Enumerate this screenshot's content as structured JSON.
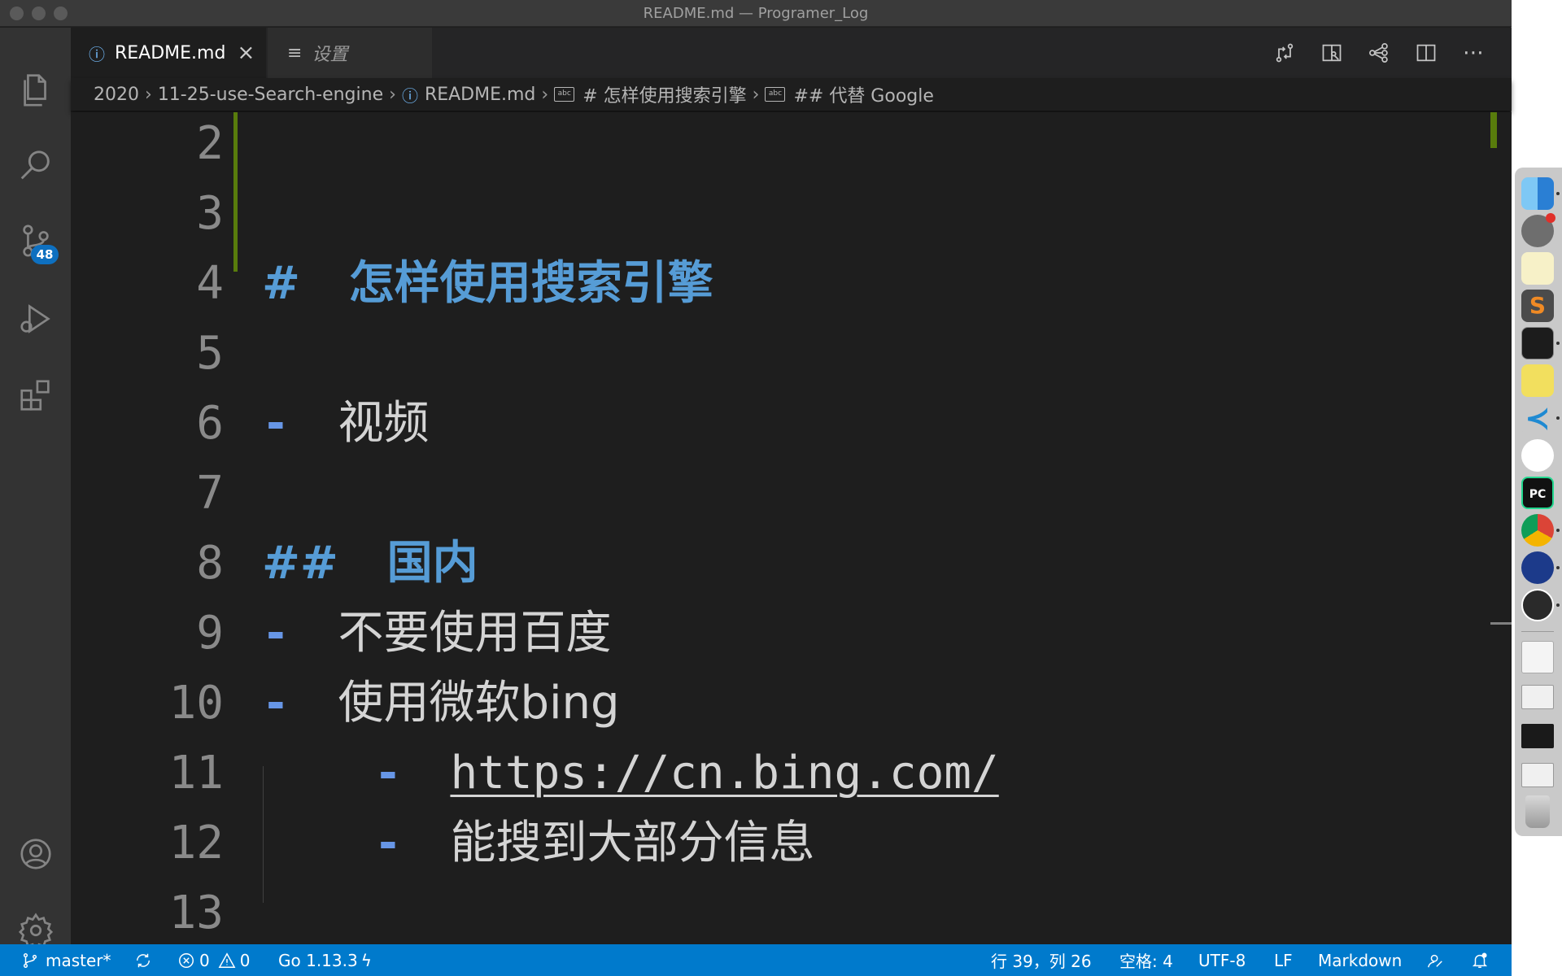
{
  "window": {
    "title": "README.md — Programer_Log"
  },
  "activity_bar": {
    "items": [
      "explorer-icon",
      "search-icon",
      "source-control-icon",
      "run-debug-icon",
      "extensions-icon",
      "accounts-icon",
      "settings-gear-icon"
    ],
    "scm_badge": "48"
  },
  "tabs": [
    {
      "label": "README.md",
      "icon": "info-icon",
      "active": true
    },
    {
      "label": "设置",
      "icon": "settings-list-icon",
      "active": false
    }
  ],
  "toolbar": [
    "open-changes-icon",
    "open-preview-side-icon",
    "outline-graph-icon",
    "split-editor-icon",
    "more-actions-icon"
  ],
  "breadcrumb": {
    "items": [
      "2020",
      "11-25-use-Search-engine",
      "README.md",
      "# 怎样使用搜索引擎",
      "## 代替 Google"
    ]
  },
  "editor": {
    "lines": [
      {
        "num": "2",
        "text": ""
      },
      {
        "num": "3",
        "text": ""
      },
      {
        "num": "4",
        "marker": "#",
        "text": "怎样使用搜索引擎"
      },
      {
        "num": "5",
        "text": ""
      },
      {
        "num": "6",
        "marker": "-",
        "text": "视频"
      },
      {
        "num": "7",
        "text": ""
      },
      {
        "num": "8",
        "marker": "##",
        "text": "国内"
      },
      {
        "num": "9",
        "marker": "-",
        "text": "不要使用百度"
      },
      {
        "num": "10",
        "marker": "-",
        "text": "使用微软bing"
      },
      {
        "num": "11",
        "marker": "-",
        "text": "https://cn.bing.com/"
      },
      {
        "num": "12",
        "marker": "-",
        "text": "能搜到大部分信息"
      },
      {
        "num": "13",
        "text": ""
      }
    ]
  },
  "status_bar": {
    "branch": "master*",
    "errors": "0",
    "warnings": "0",
    "go_version": "Go 1.13.3",
    "cursor": "行 39，列 26",
    "spaces": "空格: 4",
    "encoding": "UTF-8",
    "eol": "LF",
    "language": "Markdown",
    "accent_color": "#007acc"
  },
  "dock": {
    "apps": [
      "finder-icon",
      "system-preferences-icon",
      "notes-icon",
      "sublime-text-icon",
      "terminal-icon",
      "stickies-icon",
      "vscode-icon",
      "siri-like-icon",
      "pycharm-icon",
      "chrome-icon",
      "media-player-icon",
      "obs-icon",
      "document-icon",
      "chrome-window-thumbnail",
      "terminal-window-thumbnail",
      "chrome-window-thumbnail-2",
      "trash-icon"
    ]
  }
}
